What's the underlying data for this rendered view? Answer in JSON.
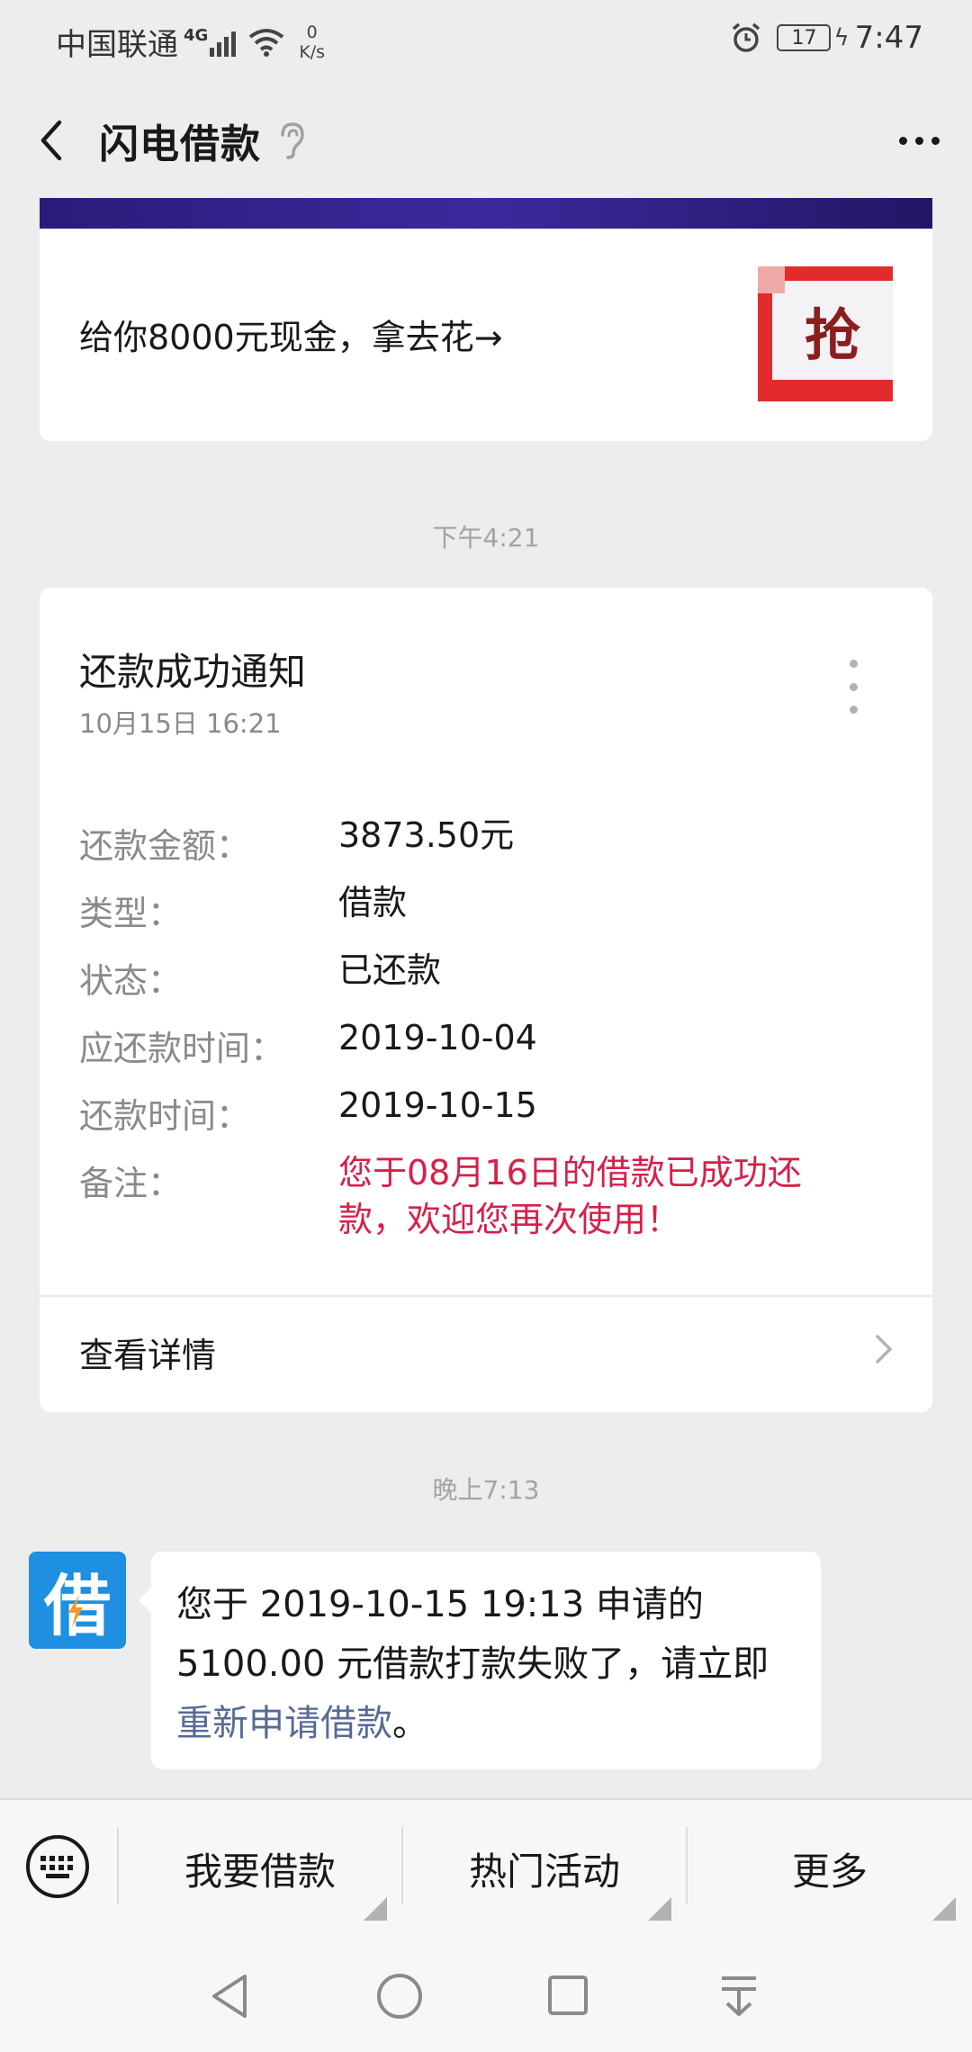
{
  "status_bar": {
    "carrier": "中国联通",
    "network": "4G",
    "speed_value": "0",
    "speed_unit": "K/s",
    "battery": "17",
    "time": "7:47"
  },
  "nav": {
    "title": "闪电借款",
    "icons": [
      "back-arrow-icon",
      "ear-icon",
      "more-icon"
    ]
  },
  "ad": {
    "text": "给你8000元现金，拿去花→",
    "badge": "抢"
  },
  "timestamps": {
    "first": "下午4:21",
    "second": "晚上7:13"
  },
  "notice": {
    "title": "还款成功通知",
    "date": "10月15日  16:21",
    "fields": [
      {
        "label": "还款金额：",
        "value": "3873.50元"
      },
      {
        "label": "类型：",
        "value": "借款"
      },
      {
        "label": "状态：",
        "value": "已还款"
      },
      {
        "label": "应还款时间：",
        "value": "2019-10-04"
      },
      {
        "label": "还款时间：",
        "value": "2019-10-15"
      },
      {
        "label": "备注：",
        "value": "您于08月16日的借款已成功还款，欢迎您再次使用！"
      }
    ],
    "detail_link": "查看详情"
  },
  "message": {
    "avatar_char": "借",
    "text_before": "您于 2019-10-15 19:13 申请的 5100.00 元借款打款失败了，请立即",
    "link_text": "重新申请借款",
    "text_after": "。"
  },
  "menu": {
    "items": [
      "我要借款",
      "热门活动",
      "更多"
    ]
  },
  "colors": {
    "accent_red": "#d6204a",
    "link_blue": "#576b95",
    "avatar_blue": "#1e8fe1",
    "background": "#ededed"
  }
}
